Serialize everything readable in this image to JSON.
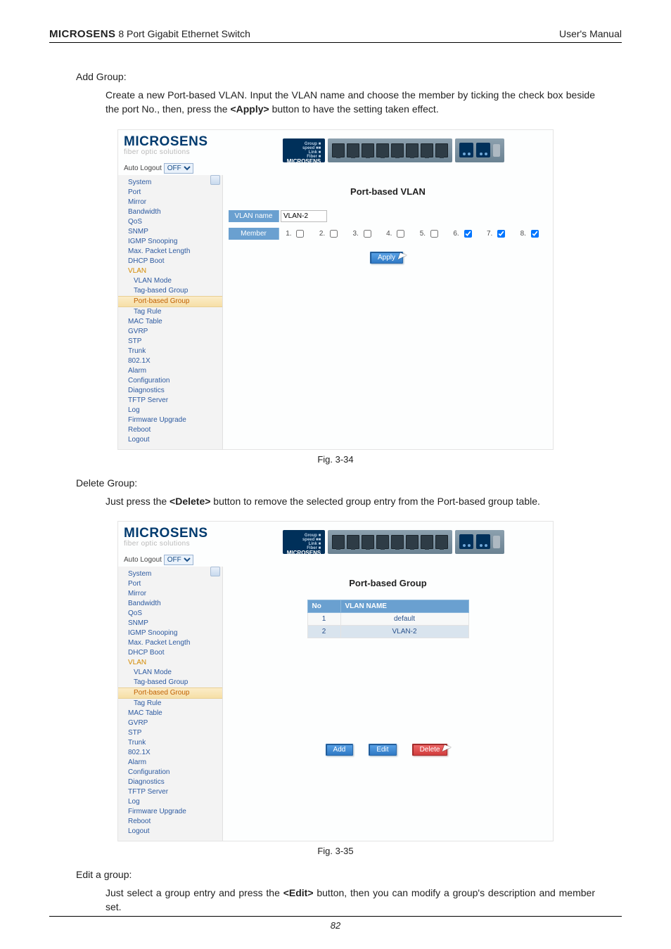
{
  "header": {
    "brand": "MICROSENS",
    "product": " 8 Port Gigabit Ethernet Switch",
    "right": "User's Manual"
  },
  "add_group": {
    "title": "Add Group:",
    "body_before": "Create a new Port-based VLAN. Input the VLAN name and choose the member by ticking the check box beside the port No., then, press the ",
    "bold": "<Apply>",
    "body_after": " button to have the setting taken effect.",
    "caption": "Fig. 3-34"
  },
  "delete_group": {
    "title": "Delete Group:",
    "body_before": "Just press the ",
    "bold": "<Delete>",
    "body_after": " button to remove the selected group entry from the Port-based group table.",
    "caption": "Fig. 3-35"
  },
  "edit_group": {
    "title": "Edit a group:",
    "body_before": "Just select a group entry and press the  ",
    "bold": "<Edit>",
    "body_after": " button, then you can modify a group's description and member set."
  },
  "shot_shared": {
    "brand": "MICROSENS",
    "brand_sub": "fiber optic solutions",
    "autologout_label": "Auto Logout",
    "autologout_value": "OFF",
    "chip_label": "MICROSENS"
  },
  "sidebar_items": [
    {
      "label": "System",
      "cls": ""
    },
    {
      "label": "Port",
      "cls": ""
    },
    {
      "label": "Mirror",
      "cls": ""
    },
    {
      "label": "Bandwidth",
      "cls": ""
    },
    {
      "label": "QoS",
      "cls": ""
    },
    {
      "label": "SNMP",
      "cls": ""
    },
    {
      "label": "IGMP Snooping",
      "cls": ""
    },
    {
      "label": "Max. Packet Length",
      "cls": ""
    },
    {
      "label": "DHCP Boot",
      "cls": ""
    },
    {
      "label": "VLAN",
      "cls": "cat"
    },
    {
      "label": "VLAN Mode",
      "cls": "sub"
    },
    {
      "label": "Tag-based Group",
      "cls": "sub"
    },
    {
      "label": "Port-based Group",
      "cls": "sub active"
    },
    {
      "label": "Tag Rule",
      "cls": "sub"
    },
    {
      "label": "MAC Table",
      "cls": ""
    },
    {
      "label": "GVRP",
      "cls": ""
    },
    {
      "label": "STP",
      "cls": ""
    },
    {
      "label": "Trunk",
      "cls": ""
    },
    {
      "label": "802.1X",
      "cls": ""
    },
    {
      "label": "Alarm",
      "cls": ""
    },
    {
      "label": "Configuration",
      "cls": ""
    },
    {
      "label": "Diagnostics",
      "cls": ""
    },
    {
      "label": "TFTP Server",
      "cls": ""
    },
    {
      "label": "Log",
      "cls": ""
    },
    {
      "label": "Firmware Upgrade",
      "cls": ""
    },
    {
      "label": "Reboot",
      "cls": ""
    },
    {
      "label": "Logout",
      "cls": ""
    }
  ],
  "shot1": {
    "pane_title": "Port-based VLAN",
    "row1_hdr": "VLAN name",
    "vlan_name_value": "VLAN-2",
    "row2_hdr": "Member",
    "members": [
      {
        "label": "1.",
        "checked": false
      },
      {
        "label": "2.",
        "checked": false
      },
      {
        "label": "3.",
        "checked": false
      },
      {
        "label": "4.",
        "checked": false
      },
      {
        "label": "5.",
        "checked": false
      },
      {
        "label": "6.",
        "checked": true
      },
      {
        "label": "7.",
        "checked": true
      },
      {
        "label": "8.",
        "checked": true
      }
    ],
    "apply_label": "Apply"
  },
  "shot2": {
    "pane_title": "Port-based Group",
    "col_no": "No",
    "col_name": "VLAN NAME",
    "rows": [
      {
        "no": "1",
        "name": "default",
        "sel": false
      },
      {
        "no": "2",
        "name": "VLAN-2",
        "sel": true
      }
    ],
    "btn_add": "Add",
    "btn_edit": "Edit",
    "btn_delete": "Delete"
  },
  "footer_page": "82"
}
